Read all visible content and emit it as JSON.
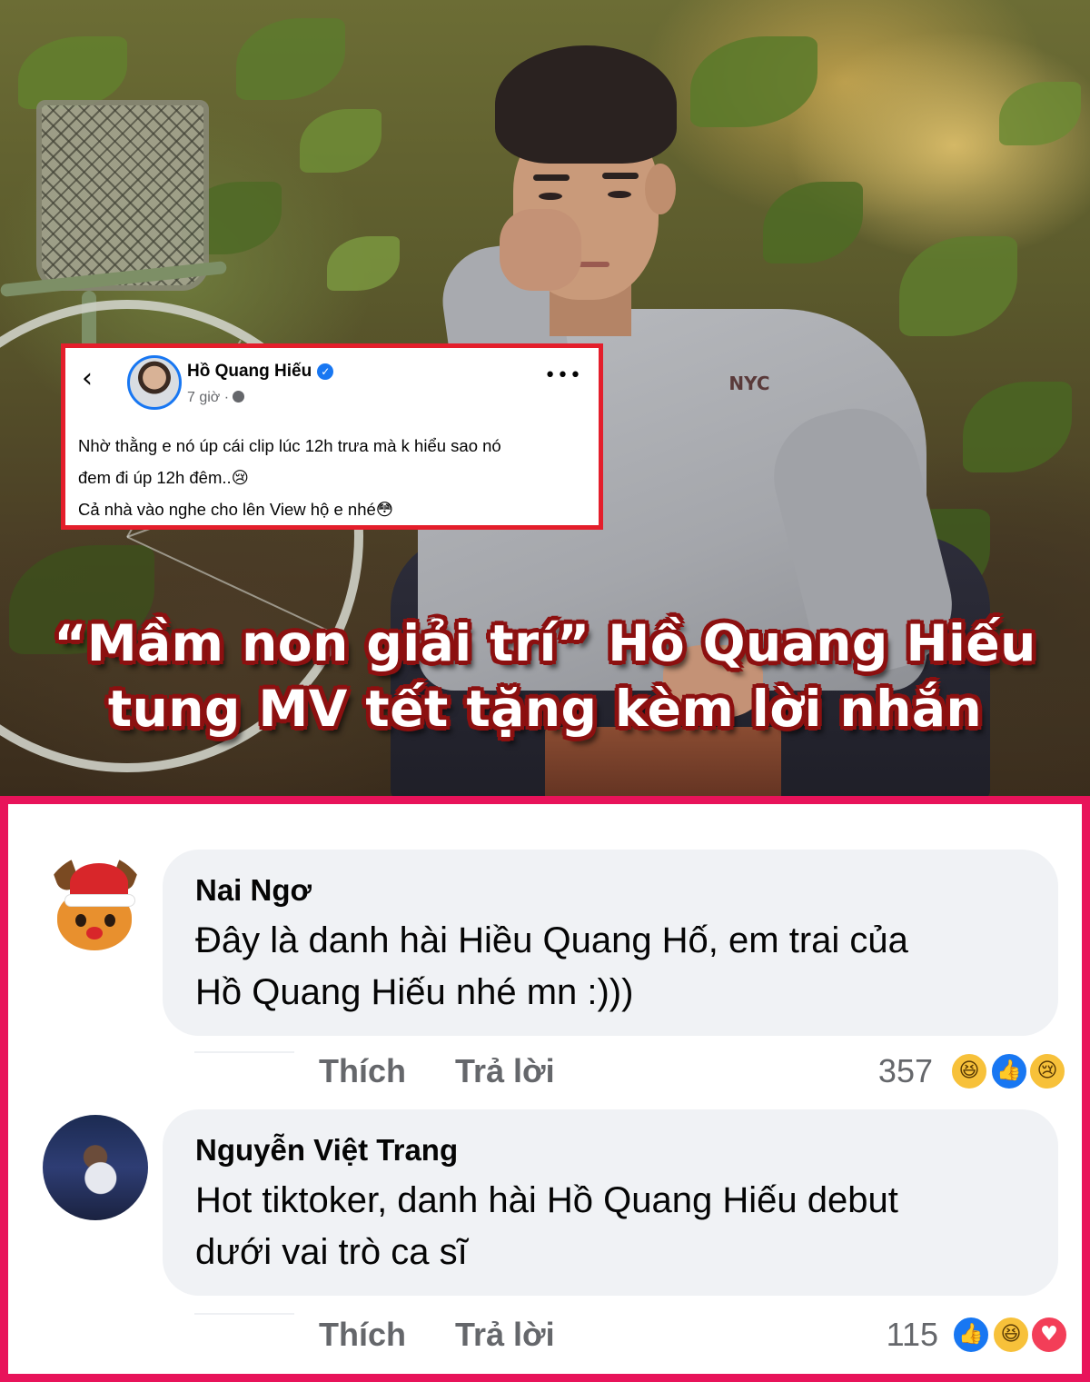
{
  "post": {
    "author": "Hồ Quang Hiếu",
    "time": "7 giờ",
    "time_separator": "·",
    "lines": [
      "Nhờ thằng e nó úp cái clip lúc 12h trưa mà k hiểu sao nó",
      "đem đi úp 12h đêm..😢",
      "Cả nhà vào nghe cho lên View hộ e nhé😳"
    ],
    "back_icon": "chevron-left-icon",
    "more_icon": "more-horizontal-icon",
    "verified_icon": "verified-badge-icon",
    "globe_icon": "globe-icon",
    "border_color": "#e41e2b"
  },
  "headline": {
    "line1": "“Mầm non giải trí” Hồ Quang Hiếu",
    "line2": "tung MV tết tặng kèm lời nhắn",
    "text_color": "#ffffff",
    "outline_color": "#8c1010"
  },
  "photo": {
    "shirt_logo": "NYC"
  },
  "comments": {
    "frame_color": "#e8135a",
    "items": [
      {
        "name": "Nai Ngơ",
        "lines": [
          "Đây là danh hài Hiều Quang Hố, em trai của",
          "Hồ Quang Hiếu nhé mn :)))"
        ],
        "like_label": "Thích",
        "reply_label": "Trả lời",
        "reaction_count": "357",
        "reactions": [
          "haha",
          "like",
          "sad"
        ]
      },
      {
        "name": "Nguyễn Việt Trang",
        "lines": [
          "Hot tiktoker, danh hài Hồ Quang Hiếu debut",
          "dưới vai trò ca sĩ"
        ],
        "like_label": "Thích",
        "reply_label": "Trả lời",
        "reaction_count": "115",
        "reactions": [
          "like",
          "haha",
          "love"
        ]
      }
    ]
  }
}
